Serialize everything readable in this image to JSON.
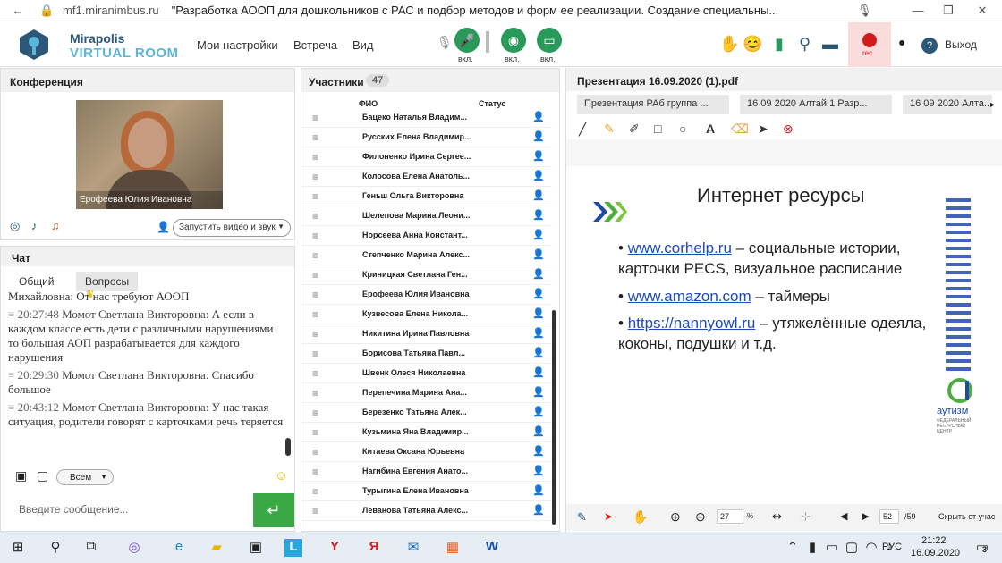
{
  "browser": {
    "url": "mf1.miranimbus.ru",
    "title": "\"Разработка АООП для дошкольников с РАС и подбор методов и форм ее реализации. Создание специальны..."
  },
  "header": {
    "logo_line1": "Mirapolis",
    "logo_line2": "VIRTUAL ROOM",
    "menu": [
      "Мои настройки",
      "Встреча",
      "Вид"
    ],
    "vkl": "вкл.",
    "rec": "rec",
    "exit": "Выход"
  },
  "conference": {
    "title": "Конференция",
    "video_caption": "Ерофеева Юлия  Ивановна",
    "launch_button": "Запустить видео и звук"
  },
  "chat": {
    "title": "Чат",
    "tab_general": "Общий",
    "tab_questions": "Вопросы",
    "entries": [
      {
        "time": "",
        "name": "",
        "text": "Михайловна: От нас требуют АООП"
      },
      {
        "time": "20:27:48",
        "name": "Момот Светлана   Викторовна:",
        "text": "А если в каждом классе есть дети с различными нарушениями то большая АОП разрабатывается для каждого нарушения"
      },
      {
        "time": "20:29:30",
        "name": "Момот Светлана   Викторовна:",
        "text": "Спасибо большое"
      },
      {
        "time": "20:43:12",
        "name": "Момот Светлана   Викторовна:",
        "text": "У нас такая ситуация, родители говорят с карточками речь теряется"
      }
    ],
    "recipient": "Всем",
    "input_placeholder": "Введите сообщение..."
  },
  "participants": {
    "title": "Участники",
    "count": "47",
    "col_name": "ФИО",
    "col_status": "Статус",
    "rows": [
      "Бацеко Наталья  Владим...",
      "Русских Елена Владимир...",
      "Филоненко Ирина Сергее...",
      "Колосова Елена  Анатоль...",
      "Геньш Ольга  Викторовна",
      "Шелепова  Марина Леони...",
      "Норсеева Анна  Констант...",
      "Степченко Марина Алекс...",
      "Криницкая Светлана  Ген...",
      "Ерофеева Юлия  Ивановна",
      "Кузвесова Елена  Никола...",
      "Никитина Ирина  Павловна",
      "Борисова Татьяна  Павл...",
      "Швенк  Олеся Николаевна",
      "Перепечина  Марина  Ана...",
      "Березенко  Татьяна Алек...",
      "Кузьмина  Яна  Владимир...",
      "Китаева Оксана  Юрьевна",
      "Нагибина Евгения  Анато...",
      "Турыгина  Елена Ивановна",
      "Леванова Татьяна  Алекс..."
    ]
  },
  "presentation": {
    "title": "Презентация 16.09.2020 (1).pdf",
    "tabs": [
      "Презентация РАб группа ...",
      "16 09 2020 Алтай  1 Разр...",
      "16 09 2020 Алта..."
    ],
    "slide_title": "Интернет ресурсы",
    "bullets": [
      {
        "link": "www.corhelp.ru",
        "text": " – социальные истории,",
        "line2": "карточки PECS, визуальное расписание"
      },
      {
        "link": "www.amazon.com",
        "text": " – таймеры",
        "line2": ""
      },
      {
        "link": "https://nannyowl.ru",
        "text": " – утяжелённые одеяла,",
        "line2": "коконы, подушки и т.д."
      }
    ],
    "logo_text": "аутизм",
    "logo_subtext": "ФЕДЕРАЛЬНЫЙ РЕСУРСНЫЙ ЦЕНТР",
    "zoom": "27",
    "zoom_unit": "%",
    "page": "52",
    "page_total": "/59",
    "hide_label": "Скрыть от учас"
  },
  "taskbar": {
    "lang": "РУС",
    "time": "21:22",
    "date": "16.09.2020",
    "notifications": "3"
  }
}
